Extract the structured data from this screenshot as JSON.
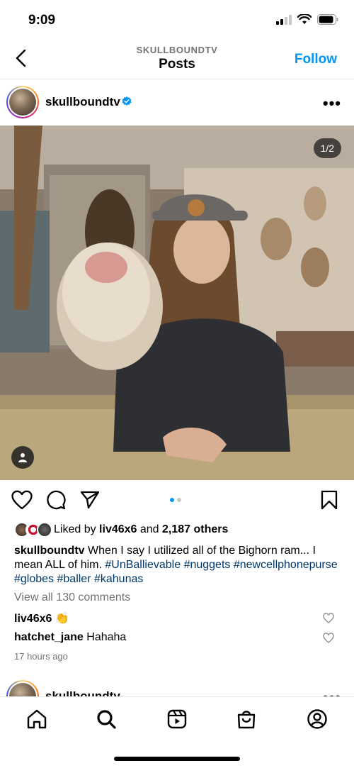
{
  "status_bar": {
    "time": "9:09"
  },
  "nav": {
    "subtitle": "SKULLBOUNDTV",
    "title": "Posts",
    "follow_label": "Follow"
  },
  "post": {
    "username": "skullboundtv",
    "verified": true,
    "photo_counter": "1/2",
    "carousel": {
      "count": 2,
      "active_index": 0
    },
    "likes": {
      "prefix": "Liked by ",
      "first_liker": "liv46x6",
      "connector": " and ",
      "others": "2,187 others"
    },
    "caption": {
      "username": "skullboundtv",
      "text": "When I say I utilized all of the Bighorn ram... I mean ALL of him.",
      "hashtags": [
        "#UnBallievable",
        "#nuggets",
        "#newcellphonepurse",
        "#globes",
        "#baller",
        "#kahunas"
      ]
    },
    "view_comments": "View all 130 comments",
    "comments": [
      {
        "username": "liv46x6",
        "text": "👏"
      },
      {
        "username": "hatchet_jane",
        "text": "Hahaha"
      }
    ],
    "timestamp": "17 hours ago"
  },
  "next_post": {
    "username": "skullboundtv"
  },
  "tabs": [
    "home-tab",
    "search-tab",
    "reels-tab",
    "shop-tab",
    "profile-tab"
  ],
  "colors": {
    "accent": "#0095f6",
    "verified": "#0095f6",
    "hashtag": "#00376b",
    "muted": "#737373",
    "carousel_active": "#0095f6",
    "carousel_inactive": "#c7c7c7"
  }
}
